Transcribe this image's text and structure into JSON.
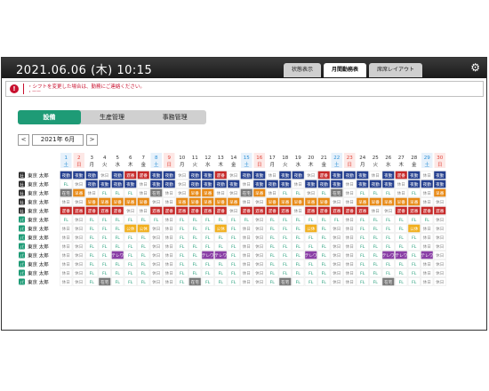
{
  "header": {
    "datetime": "2021.06.06 (木) 10:15"
  },
  "tabs": [
    {
      "label": "状態表示",
      "active": false
    },
    {
      "label": "月間勤務表",
      "active": true
    },
    {
      "label": "席席レイアウト",
      "active": false
    }
  ],
  "alert": {
    "line1": "・シフトを変更した場合は、勤務にご連絡ください。",
    "line2": "・ーー"
  },
  "departments": [
    {
      "label": "設備",
      "active": true
    },
    {
      "label": "生産管理",
      "active": false
    },
    {
      "label": "事務管理",
      "active": false
    }
  ],
  "month": {
    "prev": "<",
    "label": "2021年 6月",
    "next": ">"
  },
  "colors": {
    "accent": "#1e9b76",
    "saturday": "#2a8fd6",
    "sunday": "#e0443a",
    "header_bg": "#2b2b2b"
  },
  "days": [
    {
      "d": "1",
      "w": "土"
    },
    {
      "d": "2",
      "w": "日"
    },
    {
      "d": "3",
      "w": "月"
    },
    {
      "d": "4",
      "w": "火"
    },
    {
      "d": "5",
      "w": "水"
    },
    {
      "d": "6",
      "w": "木"
    },
    {
      "d": "7",
      "w": "金"
    },
    {
      "d": "8",
      "w": "土"
    },
    {
      "d": "9",
      "w": "日"
    },
    {
      "d": "10",
      "w": "月"
    },
    {
      "d": "11",
      "w": "火"
    },
    {
      "d": "12",
      "w": "水"
    },
    {
      "d": "13",
      "w": "木"
    },
    {
      "d": "14",
      "w": "金"
    },
    {
      "d": "15",
      "w": "土"
    },
    {
      "d": "16",
      "w": "日"
    },
    {
      "d": "17",
      "w": "月"
    },
    {
      "d": "18",
      "w": "火"
    },
    {
      "d": "19",
      "w": "水"
    },
    {
      "d": "20",
      "w": "木"
    },
    {
      "d": "21",
      "w": "金"
    },
    {
      "d": "22",
      "w": "土"
    },
    {
      "d": "23",
      "w": "日"
    },
    {
      "d": "24",
      "w": "月"
    },
    {
      "d": "25",
      "w": "火"
    },
    {
      "d": "26",
      "w": "水"
    },
    {
      "d": "27",
      "w": "木"
    },
    {
      "d": "28",
      "w": "金"
    },
    {
      "d": "29",
      "w": "土"
    },
    {
      "d": "30",
      "w": "日"
    }
  ],
  "shift_colors": {
    "夜勤": "#243f8f",
    "遅番": "#c62828",
    "早番": "#e88a16",
    "休日": "#ffffff",
    "FL": "#ffffff",
    "公休": "#f2b01e",
    "テレワ": "#8a3fa6",
    "在宅": "#7a7a7a"
  },
  "employees": [
    {
      "icon": "社",
      "name": "東京 太郎",
      "shifts": [
        "夜勤",
        "夜勤",
        "夜勤",
        "休日",
        "夜勤",
        "遅番",
        "遅番",
        "夜勤",
        "夜勤",
        "休日",
        "夜勤",
        "夜勤",
        "遅番",
        "休日",
        "夜勤",
        "夜勤",
        "休日",
        "夜勤",
        "夜勤",
        "休日",
        "遅番",
        "夜勤",
        "夜勤",
        "夜勤",
        "休日",
        "夜勤",
        "遅番",
        "夜勤",
        "休日",
        "夜勤"
      ]
    },
    {
      "icon": "社",
      "name": "東京 太郎",
      "shifts": [
        "FL",
        "休日",
        "夜勤",
        "夜勤",
        "夜勤",
        "夜勤",
        "休日",
        "夜勤",
        "夜勤",
        "休日",
        "夜勤",
        "夜勤",
        "夜勤",
        "夜勤",
        "休日",
        "夜勤",
        "夜勤",
        "夜勤",
        "休日",
        "夜勤",
        "夜勤",
        "夜勤",
        "休日",
        "夜勤",
        "夜勤",
        "夜勤",
        "休日",
        "夜勤",
        "夜勤",
        "夜勤"
      ]
    },
    {
      "icon": "社",
      "name": "東京 太郎",
      "shifts": [
        "在宅",
        "早番",
        "休日",
        "FL",
        "FL",
        "FL",
        "休日",
        "在宅",
        "休日",
        "休日",
        "早番",
        "早番",
        "休日",
        "休日",
        "在宅",
        "早番",
        "休日",
        "FL",
        "FL",
        "休日",
        "FL",
        "在宅",
        "休日",
        "FL",
        "FL",
        "FL",
        "休日",
        "FL",
        "休日",
        "早番"
      ]
    },
    {
      "icon": "社",
      "name": "東京 太郎",
      "shifts": [
        "休日",
        "休日",
        "早番",
        "早番",
        "早番",
        "早番",
        "早番",
        "休日",
        "休日",
        "早番",
        "早番",
        "早番",
        "早番",
        "早番",
        "休日",
        "休日",
        "早番",
        "早番",
        "早番",
        "早番",
        "早番",
        "休日",
        "休日",
        "早番",
        "早番",
        "早番",
        "早番",
        "早番",
        "休日",
        "休日"
      ]
    },
    {
      "icon": "社",
      "name": "東京 太郎",
      "shifts": [
        "遅番",
        "遅番",
        "遅番",
        "遅番",
        "遅番",
        "休日",
        "休日",
        "遅番",
        "遅番",
        "遅番",
        "遅番",
        "遅番",
        "遅番",
        "休日",
        "遅番",
        "遅番",
        "遅番",
        "遅番",
        "休日",
        "遅番",
        "遅番",
        "遅番",
        "遅番",
        "遅番",
        "休日",
        "休日",
        "遅番",
        "遅番",
        "遅番",
        "遅番"
      ]
    },
    {
      "icon": "パ",
      "name": "東京 太郎",
      "shifts": [
        "FL",
        "休日",
        "FL",
        "FL",
        "FL",
        "FL",
        "FL",
        "FL",
        "休日",
        "FL",
        "FL",
        "FL",
        "FL",
        "FL",
        "FL",
        "休日",
        "FL",
        "FL",
        "FL",
        "FL",
        "FL",
        "FL",
        "休日",
        "FL",
        "FL",
        "FL",
        "FL",
        "FL",
        "FL",
        "休日"
      ]
    },
    {
      "icon": "パ",
      "name": "東京 太郎",
      "shifts": [
        "休日",
        "休日",
        "FL",
        "FL",
        "FL",
        "公休",
        "公休",
        "休日",
        "休日",
        "FL",
        "FL",
        "FL",
        "公休",
        "FL",
        "休日",
        "休日",
        "FL",
        "FL",
        "FL",
        "公休",
        "FL",
        "休日",
        "休日",
        "FL",
        "FL",
        "FL",
        "FL",
        "公休",
        "休日",
        "休日"
      ]
    },
    {
      "icon": "パ",
      "name": "東京 太郎",
      "shifts": [
        "休日",
        "休日",
        "FL",
        "FL",
        "FL",
        "FL",
        "FL",
        "休日",
        "休日",
        "FL",
        "FL",
        "FL",
        "FL",
        "FL",
        "休日",
        "休日",
        "FL",
        "FL",
        "FL",
        "FL",
        "FL",
        "休日",
        "休日",
        "FL",
        "FL",
        "FL",
        "FL",
        "FL",
        "休日",
        "休日"
      ]
    },
    {
      "icon": "パ",
      "name": "東京 太郎",
      "shifts": [
        "休日",
        "休日",
        "FL",
        "FL",
        "FL",
        "FL",
        "FL",
        "休日",
        "休日",
        "FL",
        "FL",
        "FL",
        "FL",
        "FL",
        "休日",
        "休日",
        "FL",
        "FL",
        "FL",
        "FL",
        "FL",
        "休日",
        "休日",
        "FL",
        "FL",
        "FL",
        "FL",
        "FL",
        "休日",
        "休日"
      ]
    },
    {
      "icon": "パ",
      "name": "東京 太郎",
      "shifts": [
        "休日",
        "休日",
        "FL",
        "FL",
        "テレワ",
        "FL",
        "FL",
        "休日",
        "休日",
        "FL",
        "FL",
        "テレワ",
        "テレワ",
        "FL",
        "休日",
        "休日",
        "FL",
        "FL",
        "FL",
        "テレワ",
        "FL",
        "休日",
        "休日",
        "FL",
        "FL",
        "テレワ",
        "テレワ",
        "FL",
        "テレワ",
        "休日"
      ]
    },
    {
      "icon": "パ",
      "name": "東京 太郎",
      "shifts": [
        "休日",
        "休日",
        "FL",
        "FL",
        "FL",
        "FL",
        "FL",
        "休日",
        "休日",
        "FL",
        "FL",
        "FL",
        "FL",
        "FL",
        "休日",
        "休日",
        "FL",
        "FL",
        "FL",
        "FL",
        "FL",
        "休日",
        "休日",
        "FL",
        "FL",
        "FL",
        "FL",
        "FL",
        "休日",
        "休日"
      ]
    },
    {
      "icon": "パ",
      "name": "東京 太郎",
      "shifts": [
        "休日",
        "休日",
        "FL",
        "FL",
        "FL",
        "FL",
        "FL",
        "休日",
        "休日",
        "FL",
        "FL",
        "FL",
        "FL",
        "FL",
        "休日",
        "休日",
        "FL",
        "FL",
        "FL",
        "FL",
        "FL",
        "休日",
        "休日",
        "FL",
        "FL",
        "FL",
        "FL",
        "FL",
        "休日",
        "休日"
      ]
    },
    {
      "icon": "パ",
      "name": "東京 太郎",
      "shifts": [
        "休日",
        "休日",
        "FL",
        "在宅",
        "FL",
        "FL",
        "FL",
        "休日",
        "休日",
        "FL",
        "在宅",
        "FL",
        "FL",
        "FL",
        "休日",
        "休日",
        "FL",
        "在宅",
        "FL",
        "FL",
        "FL",
        "休日",
        "休日",
        "FL",
        "FL",
        "在宅",
        "FL",
        "FL",
        "休日",
        "休日"
      ]
    }
  ]
}
